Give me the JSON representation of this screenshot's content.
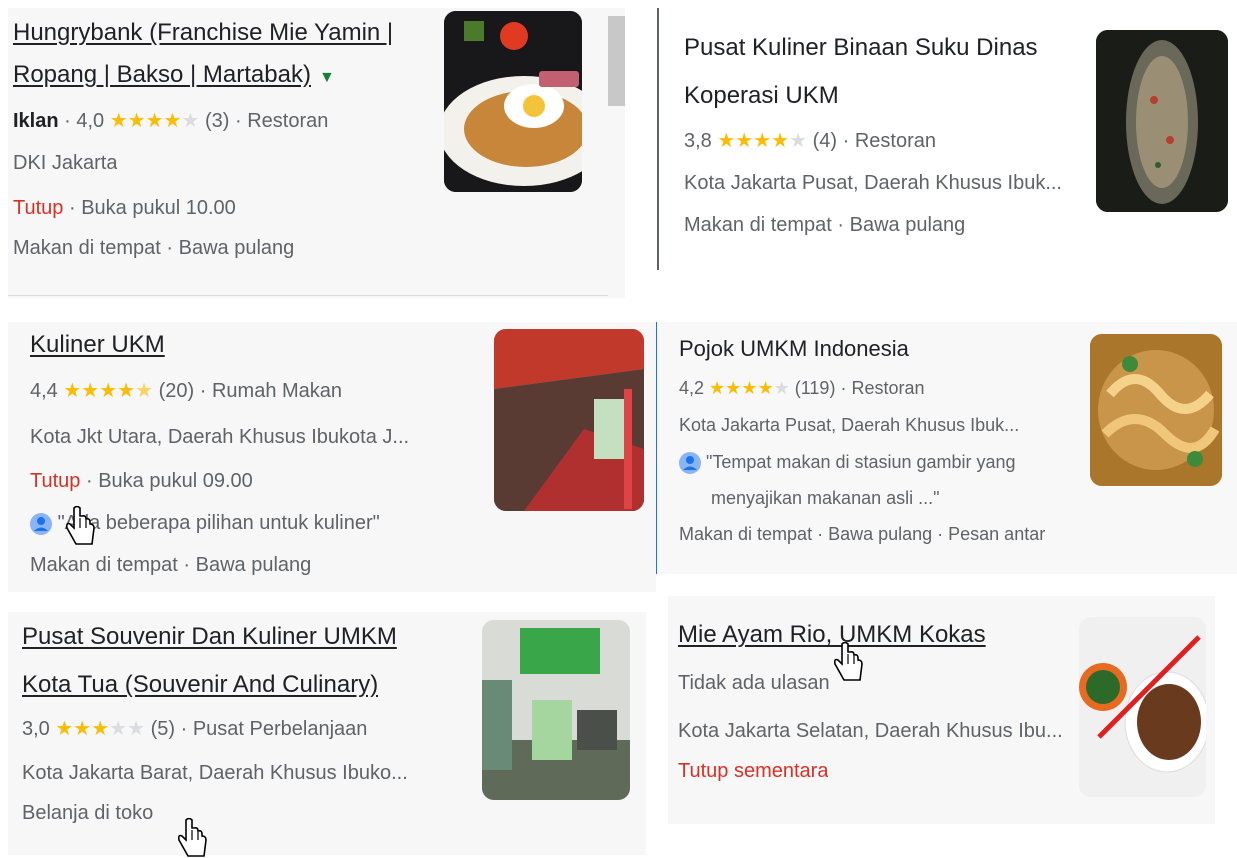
{
  "cards": [
    {
      "title_l1": "Hungrybank (Franchise Mie Yamin |",
      "title_l2": "Ropang | Bakso | Martabak)",
      "ad_label": "Iklan",
      "rating": "4,0",
      "stars_filled": 4,
      "reviews": "(3)",
      "category": "Restoran",
      "address": "DKI Jakarta",
      "status": "Tutup",
      "hours": "Buka pukul 10.00",
      "services": "Makan di tempat · Bawa pulang"
    },
    {
      "title_l1": "Pusat Kuliner Binaan Suku Dinas",
      "title_l2": "Koperasi UKM",
      "rating": "3,8",
      "stars_filled": 4,
      "reviews": "(4)",
      "category": "Restoran",
      "address": "Kota Jakarta Pusat, Daerah Khusus Ibuk...",
      "services": "Makan di tempat · Bawa pulang"
    },
    {
      "title": "Kuliner UKM",
      "rating": "4,4",
      "stars_filled": 4.5,
      "reviews": "(20)",
      "category": "Rumah Makan",
      "address": "Kota Jkt Utara, Daerah Khusus Ibukota J...",
      "status": "Tutup",
      "hours": "Buka pukul 09.00",
      "review_snippet": "\"Ada beberapa pilihan untuk kuliner\"",
      "services": "Makan di tempat · Bawa pulang"
    },
    {
      "title": "Pojok UMKM Indonesia",
      "rating": "4,2",
      "stars_filled": 4,
      "reviews": "(119)",
      "category": "Restoran",
      "address": "Kota Jakarta Pusat, Daerah Khusus Ibuk...",
      "review_l1": "\"Tempat makan di stasiun gambir yang",
      "review_l2": "menyajikan makanan asli ...\"",
      "services": "Makan di tempat · Bawa pulang · Pesan antar"
    },
    {
      "title_l1": "Pusat Souvenir Dan Kuliner UMKM",
      "title_l2": "Kota Tua (Souvenir And Culinary)",
      "rating": "3,0",
      "stars_filled": 3,
      "reviews": "(5)",
      "category": "Pusat Perbelanjaan",
      "address": "Kota Jakarta Barat, Daerah Khusus Ibuko...",
      "services": "Belanja di toko"
    },
    {
      "title": "Mie Ayam Rio, UMKM Kokas",
      "no_reviews": "Tidak ada ulasan",
      "address": "Kota Jakarta Selatan, Daerah Khusus Ibu...",
      "status": "Tutup sementara"
    }
  ],
  "dot": "·",
  "colors": {
    "star": "#fbbc04",
    "closed": "#d93025",
    "ad_caret": "#188038"
  }
}
